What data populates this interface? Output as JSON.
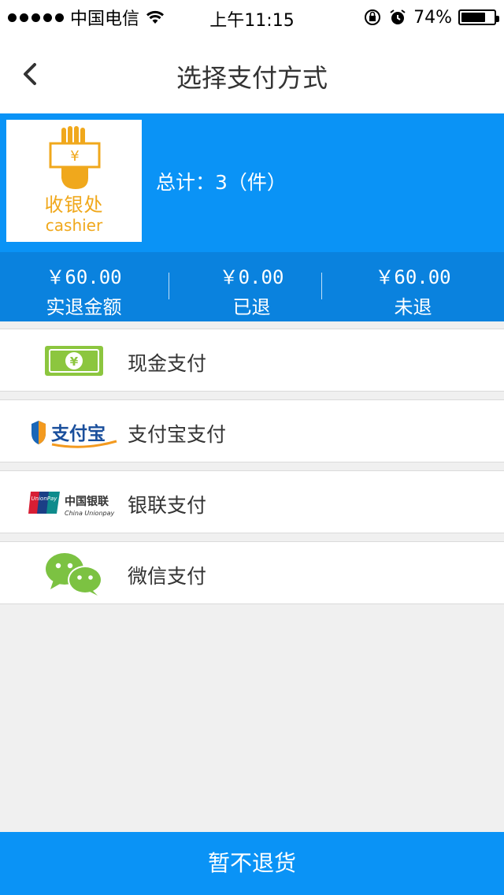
{
  "status_bar": {
    "carrier": "中国电信",
    "time": "上午11:15",
    "battery_percent": "74%",
    "battery_level": 0.74
  },
  "nav": {
    "title": "选择支付方式",
    "back_icon": "chevron-left-icon"
  },
  "order": {
    "logo_cn": "收银处",
    "logo_en": "cashier",
    "total_text": "总计：3（件）"
  },
  "summary": [
    {
      "amount": "￥60.00",
      "label": "实退金额"
    },
    {
      "amount": "￥0.00",
      "label": "已退"
    },
    {
      "amount": "￥60.00",
      "label": "未退"
    }
  ],
  "payments": [
    {
      "label": "现金支付",
      "icon": "cash-icon"
    },
    {
      "label": "支付宝支付",
      "icon": "alipay-icon"
    },
    {
      "label": "银联支付",
      "icon": "unionpay-icon"
    },
    {
      "label": "微信支付",
      "icon": "wechat-icon"
    }
  ],
  "alipay_logo_text": "支付宝",
  "unionpay_logo": {
    "cn": "中国银联",
    "en": "China Unionpay",
    "badge": "UnionPay"
  },
  "bottom_button": "暂不退货",
  "colors": {
    "header_blue": "#0a93f6",
    "summary_blue": "#0a82de",
    "logo_orange": "#f0a81c",
    "cash_green": "#8cc63f",
    "wechat_green": "#7cc242"
  }
}
